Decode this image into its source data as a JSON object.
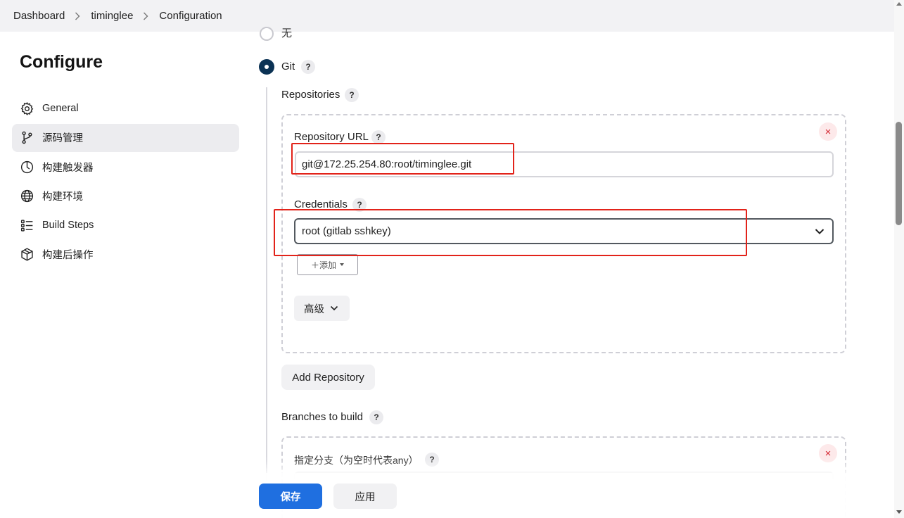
{
  "breadcrumb": {
    "items": [
      "Dashboard",
      "timinglee",
      "Configuration"
    ]
  },
  "sidebar": {
    "title": "Configure",
    "items": [
      {
        "label": "General",
        "icon": "gear-icon"
      },
      {
        "label": "源码管理",
        "icon": "branch-icon",
        "active": true
      },
      {
        "label": "构建触发器",
        "icon": "clock-icon"
      },
      {
        "label": "构建环境",
        "icon": "globe-icon"
      },
      {
        "label": "Build Steps",
        "icon": "list-icon"
      },
      {
        "label": "构建后操作",
        "icon": "package-icon"
      }
    ]
  },
  "scm": {
    "option_none_label": "无",
    "option_git_label": "Git",
    "help_glyph": "?",
    "repositories_label": "Repositories",
    "repository_url_label": "Repository URL",
    "repository_url_value": "git@172.25.254.80:root/timinglee.git",
    "credentials_label": "Credentials",
    "credentials_value": "root (gitlab sshkey)",
    "add_button_label": "＋添加",
    "advanced_label": "高级",
    "add_repository_label": "Add Repository",
    "branches_label": "Branches to build",
    "branch_specifier_label": "指定分支（为空时代表any）",
    "remove_glyph": "×"
  },
  "actions": {
    "save_label": "保存",
    "apply_label": "应用"
  },
  "colors": {
    "primary": "#1f6fe0",
    "radio_selected": "#0b3254",
    "highlight_box": "#e2231a",
    "remove_icon": "#d4242f"
  }
}
